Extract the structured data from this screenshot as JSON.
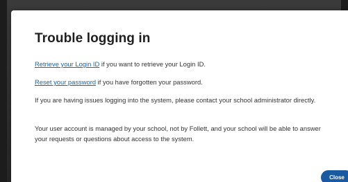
{
  "dialog": {
    "title": "Trouble logging in",
    "retrieve_link": "Retrieve your Login ID",
    "retrieve_text": " if you want to retrieve your Login ID.",
    "reset_link": "Reset your password",
    "reset_text": " if you have forgotten your password.",
    "contact_text": "If you are having issues logging into the system, please contact your school administrator directly.",
    "managed_text": "Your user account is managed by your school, not by Follett, and your school will be able to answer your requests or questions about access to the system.",
    "close_label": "Close"
  },
  "colors": {
    "link": "#1565a8",
    "button": "#1a5aa0",
    "overlay": "#2b2b2b"
  }
}
